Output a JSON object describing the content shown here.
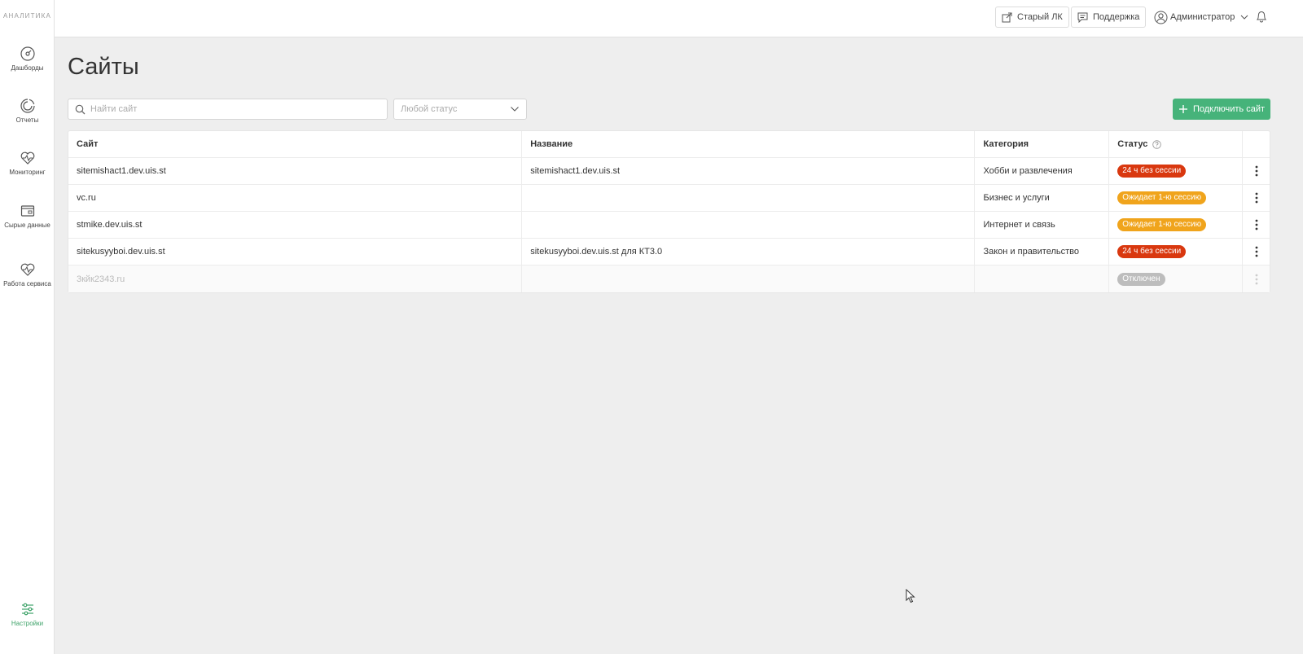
{
  "sidebar": {
    "brand": "АНАЛИТИКА",
    "items": [
      {
        "label": "Дашборды",
        "icon": "dashboard-icon"
      },
      {
        "label": "Отчеты",
        "icon": "reports-icon"
      },
      {
        "label": "Мониторинг",
        "icon": "monitoring-icon"
      },
      {
        "label": "Сырые данные",
        "icon": "raw-data-icon"
      },
      {
        "label": "Работа сервиса",
        "icon": "service-health-icon"
      },
      {
        "label": "Настройки",
        "icon": "settings-sliders-icon"
      }
    ],
    "active_color": "#3fa36a"
  },
  "topbar": {
    "old_lk": "Старый ЛК",
    "support": "Поддержка",
    "user": "Администратор"
  },
  "page": {
    "title": "Сайты",
    "search_placeholder": "Найти сайт",
    "status_filter": "Любой статус",
    "connect_button": "Подключить сайт",
    "accent_color": "#46b37a"
  },
  "table": {
    "columns": [
      "Сайт",
      "Название",
      "Категория",
      "Статус"
    ],
    "rows": [
      {
        "site": "sitemishact1.dev.uis.st",
        "name": "sitemishact1.dev.uis.st",
        "category": "Хобби и развлечения",
        "status": "24 ч без сессии",
        "status_color": "#d9380f"
      },
      {
        "site": "vc.ru",
        "name": "",
        "category": "Бизнес и услуги",
        "status": "Ожидает 1-ю сессию",
        "status_color": "#f0a41c"
      },
      {
        "site": "stmike.dev.uis.st",
        "name": "",
        "category": "Интернет и связь",
        "status": "Ожидает 1-ю сессию",
        "status_color": "#f0a41c"
      },
      {
        "site": "sitekusyyboi.dev.uis.st",
        "name": "sitekusyyboi.dev.uis.st для КТ3.0",
        "category": "Закон и правительство",
        "status": "24 ч без сессии",
        "status_color": "#d9380f"
      },
      {
        "site": "3кйк2343.ru",
        "name": "",
        "category": "",
        "status": "Отключен",
        "status_color": "#bdbdbd"
      }
    ]
  }
}
